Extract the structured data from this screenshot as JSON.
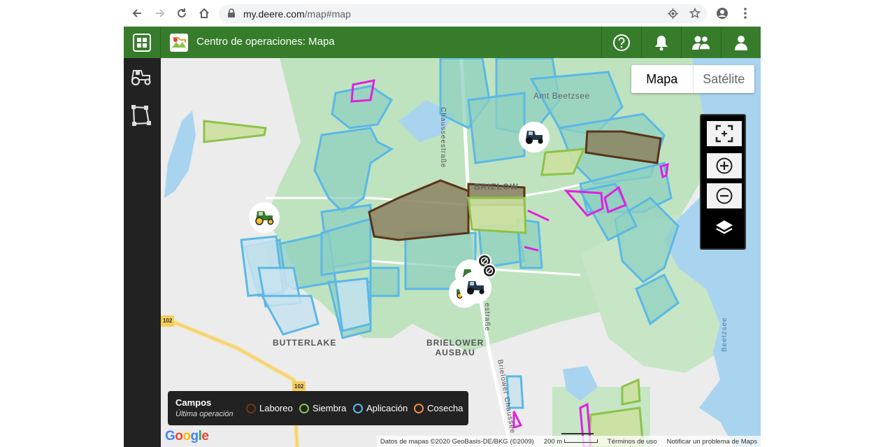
{
  "browser": {
    "url_host": "my.deere.com",
    "url_path": "/map#map"
  },
  "app": {
    "title": "Centro de operaciones: Mapa"
  },
  "map_type": {
    "map_label": "Mapa",
    "satellite_label": "Satélite",
    "selected": "Mapa"
  },
  "map_labels": {
    "amt": "Amt Beetzsee",
    "brielow": "BRIELOW",
    "butterlake": "BUTTERLAKE",
    "brielower_ausbau": "BRIELOWER\nAUSBAU",
    "chaussee": "Chausseestraße",
    "beetzsee": "Beetzsee",
    "road_102_a": "102",
    "road_102_b": "102",
    "strasse": "estraße",
    "brielower_chaussee": "Brielower Chaussee"
  },
  "legend": {
    "title": "Campos",
    "subtitle": "Última operación",
    "items": [
      {
        "label": "Laboreo",
        "color": "#6b3a1e"
      },
      {
        "label": "Siembra",
        "color": "#8cc24a"
      },
      {
        "label": "Aplicación",
        "color": "#5bb8e6"
      },
      {
        "label": "Cosecha",
        "color": "#f08a4b"
      }
    ]
  },
  "attribution": {
    "data": "Datos de mapas ©2020 GeoBasis-DE/BKG (©2009)",
    "scale": "200 m",
    "terms": "Términos de uso",
    "report": "Notificar un problema de Maps"
  },
  "google_logo": "Google",
  "colors": {
    "deere_green": "#367c2b",
    "field_application": "#5bb8e6",
    "field_tillage": "#5a3417",
    "field_seeding": "#8cc24a",
    "boundary_magenta": "#e020e0",
    "water": "#a8d4f0",
    "vegetation": "#bfe3bf"
  }
}
